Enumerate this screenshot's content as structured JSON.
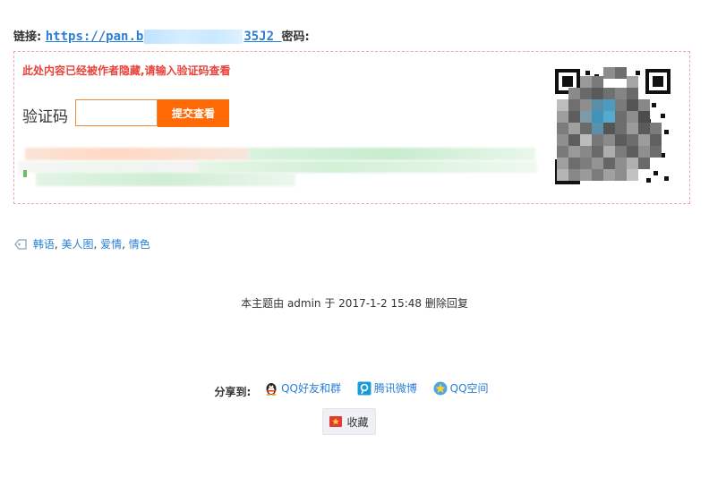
{
  "link_line": {
    "label": "链接:",
    "url_prefix": "https://pan.b",
    "url_suffix": "35J2",
    "password_label": "密码:"
  },
  "hidden_content": {
    "notice": "此处内容已经被作者隐藏,请输入验证码查看",
    "captcha_label": "验证码",
    "captcha_value": "",
    "submit_label": "提交查看"
  },
  "tags": [
    "韩语",
    "美人图",
    "爱情",
    "情色"
  ],
  "meta": {
    "text": "本主题由 admin 于 2017-1-2 15:48 删除回复"
  },
  "share": {
    "label": "分享到:",
    "items": [
      {
        "label": "QQ好友和群",
        "icon": "qq-penguin-icon"
      },
      {
        "label": "腾讯微博",
        "icon": "tencent-weibo-icon"
      },
      {
        "label": "QQ空间",
        "icon": "qzone-star-icon"
      }
    ]
  },
  "favorite": {
    "label": "收藏",
    "icon": "star-flag-icon"
  },
  "colors": {
    "link": "#2a7fd9",
    "notice": "#e8423a",
    "button": "#ff6a06",
    "dashed_border": "#f3a7a7"
  }
}
